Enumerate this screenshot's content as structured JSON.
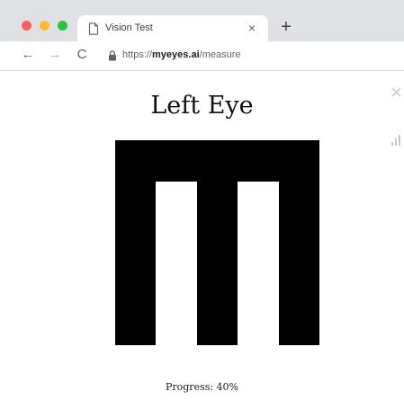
{
  "browser": {
    "tab": {
      "title": "Vision Test",
      "close_glyph": "×"
    },
    "new_tab_glyph": "+",
    "nav": {
      "back_glyph": "←",
      "forward_glyph": "→",
      "reload_glyph": "C"
    },
    "address": {
      "scheme": "https://",
      "host": "myeyes.ai",
      "path": "/measure"
    }
  },
  "page": {
    "title": "Left Eye",
    "optotype": {
      "name": "tumbling-e",
      "orientation": "opening-down",
      "color": "#000000"
    },
    "side_controls": {
      "close_glyph": "×"
    },
    "progress": {
      "text": "Progress: 40%",
      "value": 0.4
    }
  },
  "colors": {
    "chrome": "#dfe1e5",
    "traffic_red": "#fe5f57",
    "traffic_yellow": "#febc2e",
    "traffic_green": "#28c840"
  }
}
